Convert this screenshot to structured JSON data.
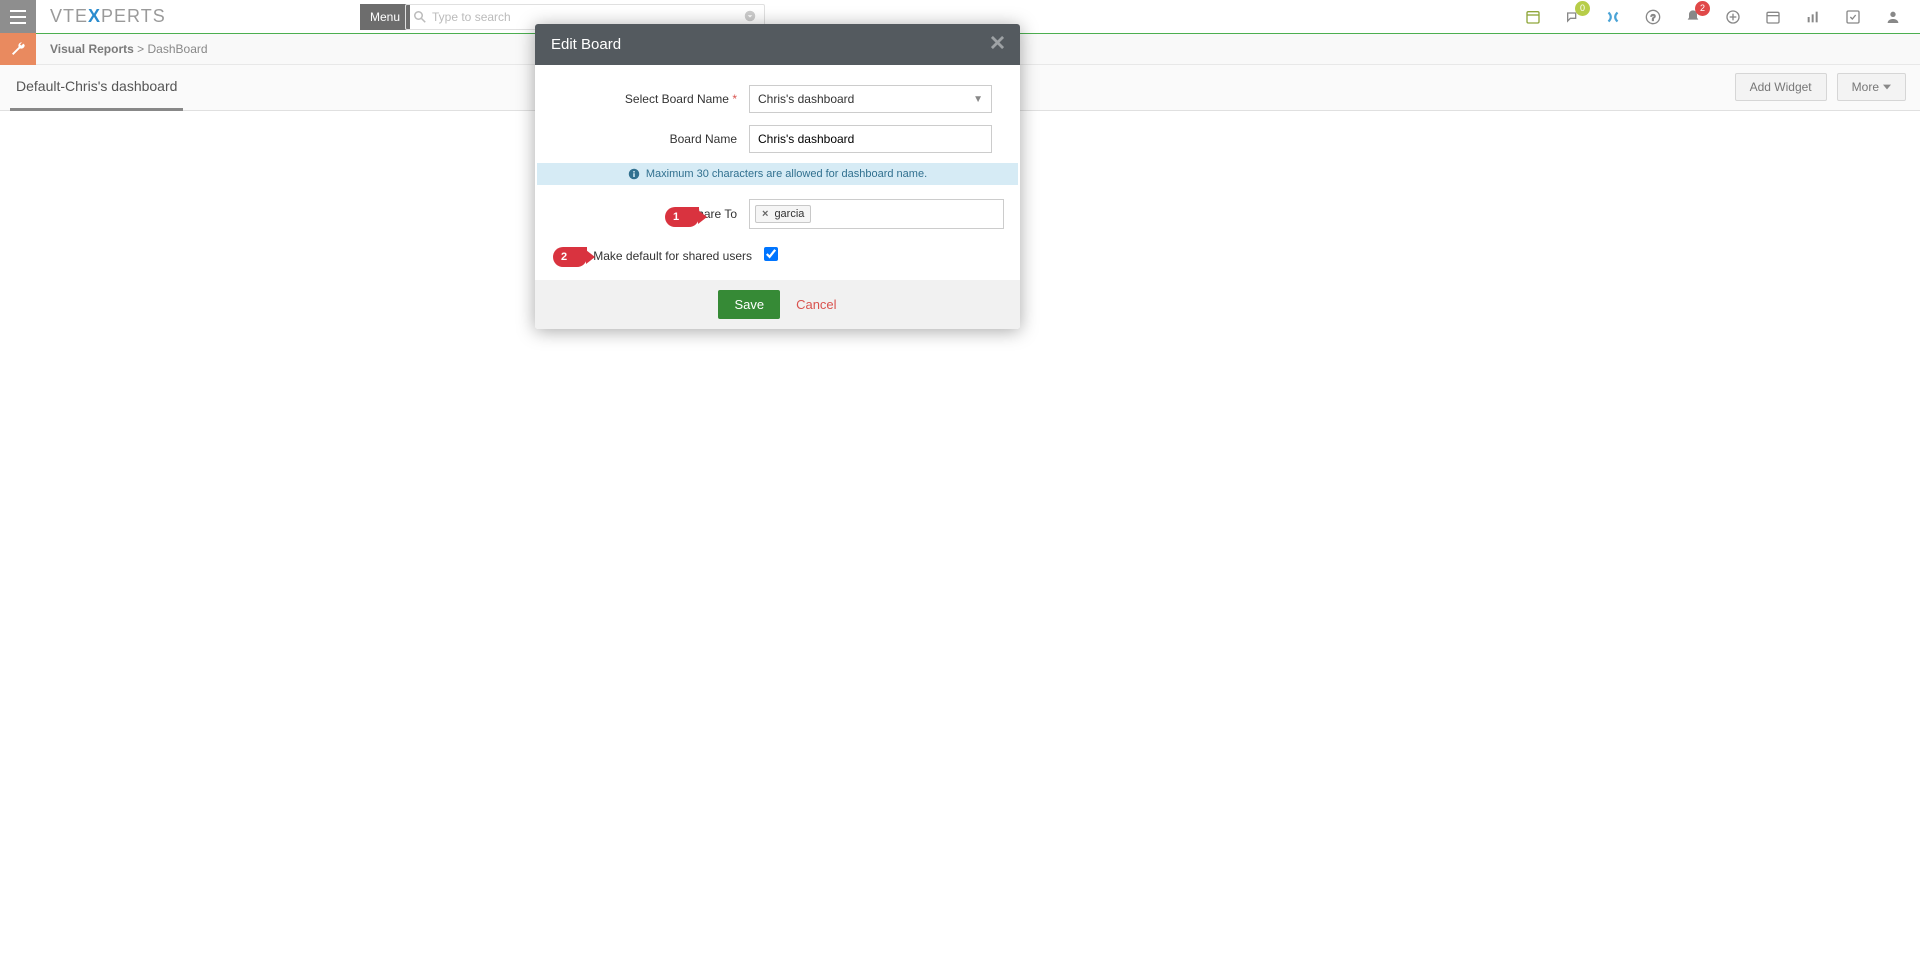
{
  "header": {
    "logo_prefix": "VTE",
    "logo_x": "X",
    "logo_suffix": "PERTS",
    "menu_label": "Menu",
    "search_placeholder": "Type to search",
    "comment_badge": "0",
    "bell_badge": "2"
  },
  "breadcrumb": {
    "module": "Visual Reports",
    "page": "DashBoard"
  },
  "tabs": {
    "active": "Default-Chris's dashboard"
  },
  "actions": {
    "add_widget": "Add Widget",
    "more": "More"
  },
  "modal": {
    "title": "Edit Board",
    "field_select_label": "Select Board Name",
    "field_select_value": "Chris's dashboard",
    "field_name_label": "Board Name",
    "field_name_value": "Chris's dashboard",
    "info_text": "Maximum 30 characters are allowed for dashboard name.",
    "share_label": "Share To",
    "share_tag": "garcia",
    "default_label": "Make default for shared users",
    "save": "Save",
    "cancel": "Cancel"
  },
  "markers": {
    "one": "1",
    "two": "2"
  }
}
